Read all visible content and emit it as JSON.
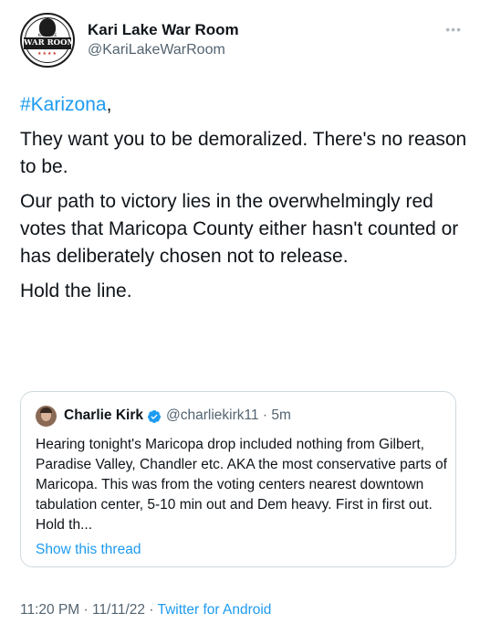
{
  "author": {
    "display_name": "Kari Lake War Room",
    "handle": "@KariLakeWarRoom",
    "avatar_banner_text": "WAR ROOM",
    "avatar_top_text": "KARI LAKE"
  },
  "more_icon": "more-horizontal-icon",
  "tweet": {
    "hashtag": "#Karizona",
    "hashtag_suffix": ",",
    "paragraph_1": "They want you to be demoralized. There's no reason to be.",
    "paragraph_2": "Our path to victory lies in the overwhelmingly red votes that Maricopa County either hasn't counted or has deliberately chosen not to release.",
    "paragraph_3": "Hold the line."
  },
  "quoted": {
    "display_name": "Charlie Kirk",
    "verified_icon": "verified-badge-icon",
    "handle_time": "@charliekirk11 · 5m",
    "text": "Hearing tonight's Maricopa drop included nothing from Gilbert, Paradise Valley, Chandler etc. AKA the most conservative parts of Maricopa. This was from the voting centers nearest downtown tabulation center, 5-10 min out and Dem heavy. First in first out. Hold th...",
    "show_thread": "Show this thread"
  },
  "footer": {
    "timestamp": "11:20 PM · 11/11/22 · ",
    "source": "Twitter for Android"
  },
  "colors": {
    "link": "#1d9bf0",
    "secondary_text": "#536471",
    "primary_text": "#0f1419",
    "border": "#cfd9de"
  }
}
